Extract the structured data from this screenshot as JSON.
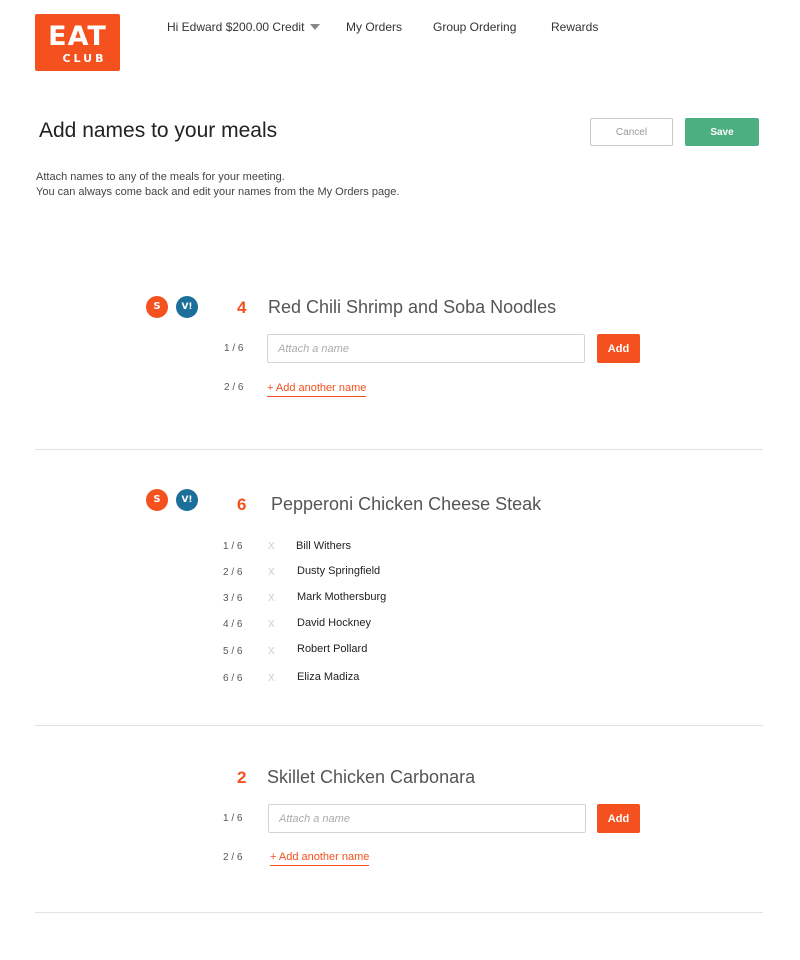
{
  "header": {
    "logo_top": "EAT",
    "logo_bottom": "CLUB",
    "greeting": "Hi Edward $200.00 Credit",
    "nav": {
      "my_orders": "My Orders",
      "group_ordering": "Group Ordering",
      "rewards": "Rewards"
    }
  },
  "page": {
    "title": "Add names to your meals",
    "cancel_label": "Cancel",
    "save_label": "Save",
    "description_line1": "Attach names to any of the meals for your meeting.",
    "description_line2": "You can always come back and edit your names from the My Orders page."
  },
  "badges": {
    "s": "S",
    "v": "V!"
  },
  "meals": [
    {
      "quantity": "4",
      "name": "Red Chili Shrimp and Soba Noodles",
      "input_slot": "1 / 6",
      "input_placeholder": "Attach a name",
      "add_label": "Add",
      "next_slot": "2 / 6",
      "add_another_label": "+ Add another name"
    },
    {
      "quantity": "6",
      "name": "Pepperoni Chicken Cheese Steak",
      "remove_glyph": "X",
      "assigned": [
        {
          "slot": "1 / 6",
          "name": "Bill Withers"
        },
        {
          "slot": "2 / 6",
          "name": "Dusty Springfield"
        },
        {
          "slot": "3 / 6",
          "name": "Mark Mothersburg"
        },
        {
          "slot": "4 / 6",
          "name": "David Hockney"
        },
        {
          "slot": "5 / 6",
          "name": "Robert Pollard"
        },
        {
          "slot": "6 / 6",
          "name": "Eliza Madiza"
        }
      ]
    },
    {
      "quantity": "2",
      "name": "Skillet Chicken Carbonara",
      "input_slot": "1 / 6",
      "input_placeholder": "Attach a name",
      "add_label": "Add",
      "next_slot": "2 / 6",
      "add_another_label": "+ Add another name"
    }
  ],
  "colors": {
    "brand": "#f4511e",
    "save": "#4caf82",
    "badge_v": "#1b6f9a"
  }
}
